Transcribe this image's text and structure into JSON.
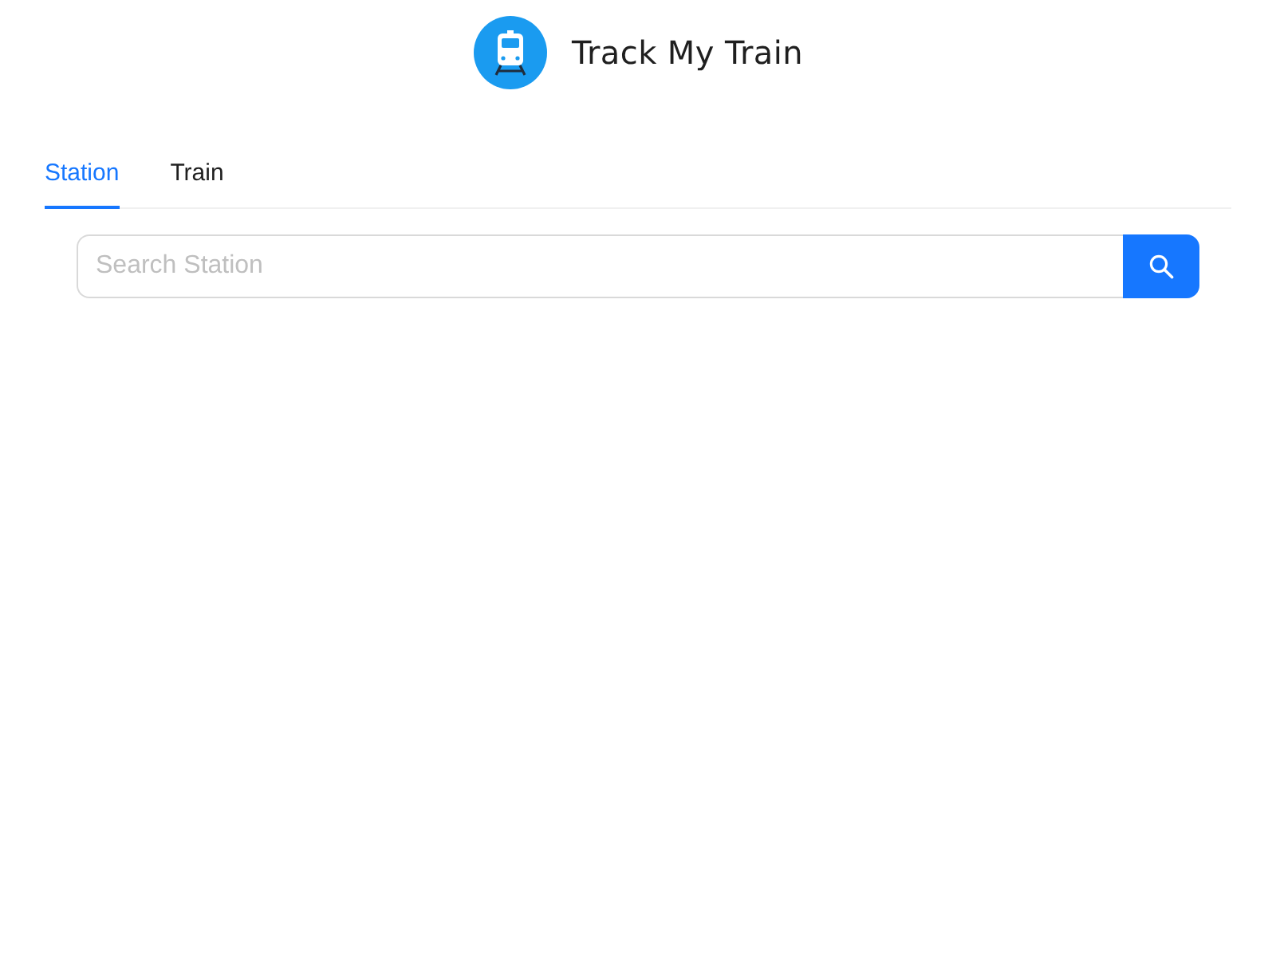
{
  "header": {
    "title": "Track My Train"
  },
  "tabs": [
    {
      "label": "Station",
      "selected": true
    },
    {
      "label": "Train",
      "selected": false
    }
  ],
  "search": {
    "placeholder": "Search Station"
  }
}
